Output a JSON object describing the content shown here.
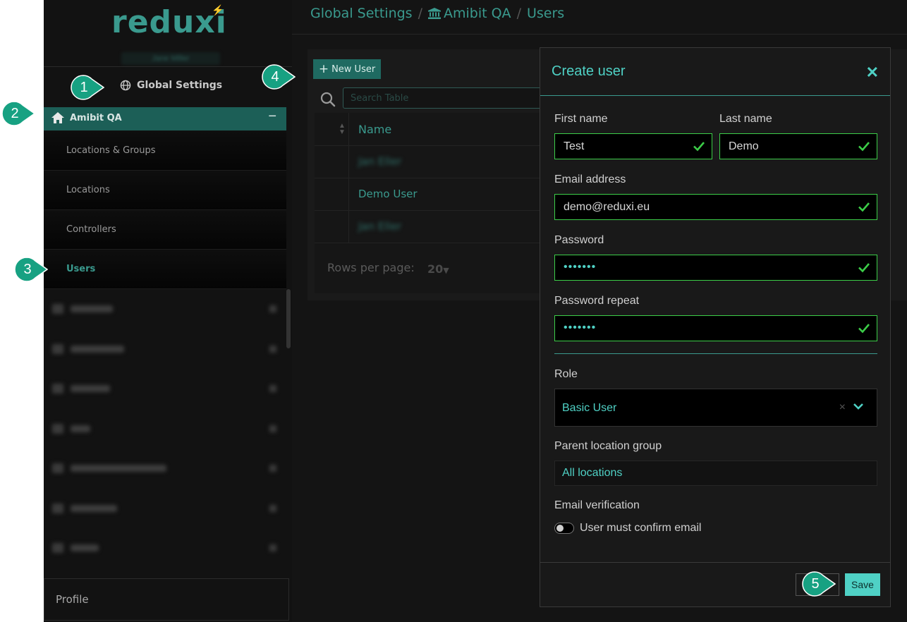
{
  "sidebar": {
    "logo": "reduxi",
    "user_tag": "Jane Miller",
    "global_settings": "Global Settings",
    "org": {
      "name": "Amibit QA",
      "collapse": "−"
    },
    "sub_items": [
      {
        "label": "Locations & Groups"
      },
      {
        "label": "Locations"
      },
      {
        "label": "Controllers"
      },
      {
        "label": "Users",
        "active": true
      }
    ],
    "profile": "Profile"
  },
  "breadcrumb": {
    "items": [
      "Global Settings",
      "Amibit QA",
      "Users"
    ],
    "separator": "/"
  },
  "toolbar": {
    "new_user": "New User",
    "search_placeholder": "Search Table"
  },
  "table": {
    "header_name": "Name",
    "rows": [
      {
        "name": "Jan Eller",
        "blurred": true
      },
      {
        "name": "Demo User",
        "blurred": false
      },
      {
        "name": "Jan Eller",
        "blurred": true
      }
    ],
    "rows_per_page_label": "Rows per page:",
    "rows_per_page_value": "20"
  },
  "dialog": {
    "title": "Create user",
    "fields": {
      "first_name": {
        "label": "First name",
        "value": "Test"
      },
      "last_name": {
        "label": "Last name",
        "value": "Demo"
      },
      "email": {
        "label": "Email address",
        "value": "demo@reduxi.eu"
      },
      "password": {
        "label": "Password",
        "value": "•••••••"
      },
      "password_repeat": {
        "label": "Password repeat",
        "value": "•••••••"
      }
    },
    "role": {
      "label": "Role",
      "value": "Basic User",
      "clear": "×"
    },
    "parent_group": {
      "label": "Parent location group",
      "value": "All locations"
    },
    "email_verification": {
      "label": "Email verification",
      "toggle_label": "User must confirm email",
      "enabled": false
    },
    "save": "Save"
  },
  "callouts": [
    "1",
    "2",
    "3",
    "4",
    "5"
  ],
  "colors": {
    "accent": "#4fd1c5",
    "brand_teal": "#3a9a8e",
    "valid_green": "#3ccd48",
    "callout": "#17a182",
    "sidebar_bg": "#121212",
    "active_org_bg": "#1c5f57"
  }
}
